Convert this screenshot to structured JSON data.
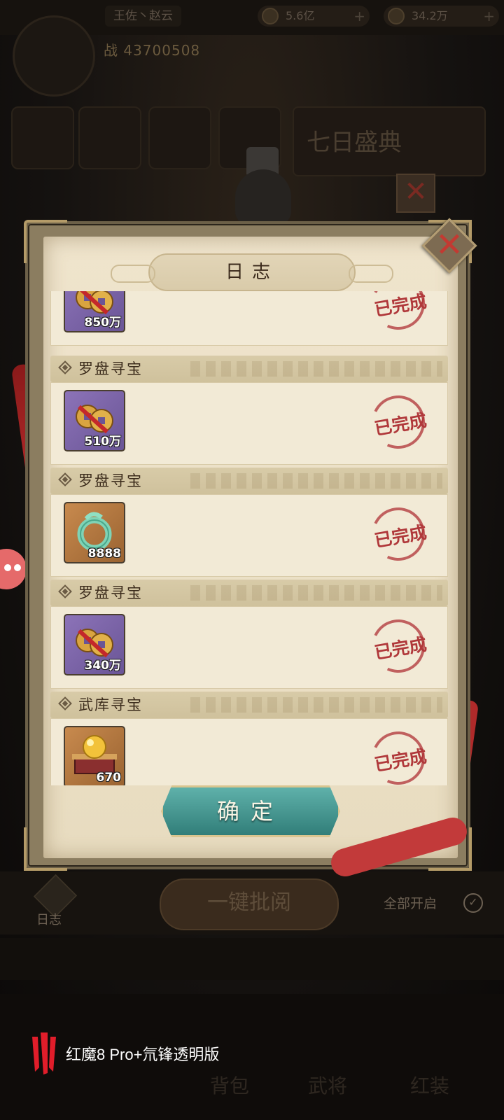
{
  "background": {
    "player_name": "王佐丶赵云",
    "resource_1": "5.6亿",
    "resource_2": "34.2万",
    "power": "战 43700508",
    "banner": "七日盛典",
    "batch_button": "一键批阅",
    "log_tab": "日志",
    "open_all": "全部开启",
    "nav_labels": [
      "背包",
      "武将",
      "红装"
    ]
  },
  "dialog": {
    "title": "日志",
    "confirm_label": "确定",
    "entries": [
      {
        "name": "",
        "item": "coins",
        "count": "850万",
        "status": "已完成"
      },
      {
        "name": "罗盘寻宝",
        "item": "coins",
        "count": "510万",
        "status": "已完成"
      },
      {
        "name": "罗盘寻宝",
        "item": "jade",
        "count": "8888",
        "status": "已完成"
      },
      {
        "name": "罗盘寻宝",
        "item": "coins",
        "count": "340万",
        "status": "已完成"
      },
      {
        "name": "武库寻宝",
        "item": "orb",
        "count": "670",
        "status": "已完成"
      }
    ]
  },
  "watermark": {
    "text": "红魔8 Pro+氘锋透明版"
  },
  "colors": {
    "stamp_red": "#b0383a",
    "confirm_teal": "#3f938d",
    "paper": "#efe4cc"
  }
}
